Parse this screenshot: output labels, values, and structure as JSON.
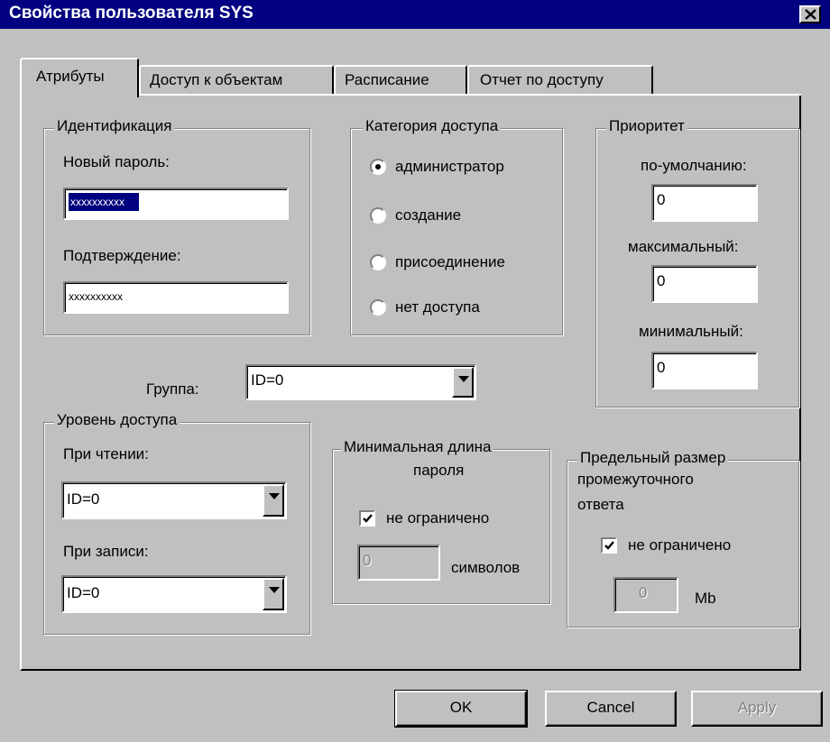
{
  "window": {
    "title": "Свойства пользователя SYS",
    "close_icon": "close-icon"
  },
  "tabs": [
    {
      "label": "Атрибуты",
      "active": true
    },
    {
      "label": "Доступ к объектам",
      "active": false
    },
    {
      "label": "Расписание",
      "active": false
    },
    {
      "label": "Отчет по доступу",
      "active": false
    }
  ],
  "identification": {
    "legend": "Идентификация",
    "new_password_label": "Новый пароль:",
    "new_password_value": "xxxxxxxxxx",
    "confirm_label": "Подтверждение:",
    "confirm_value": "xxxxxxxxxx"
  },
  "access_category": {
    "legend": "Категория доступа",
    "options": [
      {
        "label": "администратор",
        "selected": true
      },
      {
        "label": "создание",
        "selected": false
      },
      {
        "label": "присоединение",
        "selected": false
      },
      {
        "label": "нет доступа",
        "selected": false
      }
    ]
  },
  "priority": {
    "legend": "Приоритет",
    "default_label": "по-умолчанию:",
    "default_value": "0",
    "max_label": "максимальный:",
    "max_value": "0",
    "min_label": "минимальный:",
    "min_value": "0"
  },
  "group": {
    "label": "Группа:",
    "value": "ID=0"
  },
  "access_level": {
    "legend": "Уровень доступа",
    "read_label": "При чтении:",
    "read_value": "ID=0",
    "write_label": "При записи:",
    "write_value": "ID=0"
  },
  "min_password": {
    "legend_line1": "Минимальная длина",
    "legend_line2": "пароля",
    "unlimited_label": "не ограничено",
    "unlimited_checked": true,
    "length_value": "0",
    "unit_label": "символов"
  },
  "response_limit": {
    "legend": "Предельный размер",
    "line2": "промежуточного",
    "line3": "ответа",
    "unlimited_label": "не ограничено",
    "unlimited_checked": true,
    "size_value": "0",
    "unit_label": "Mb"
  },
  "buttons": {
    "ok": "OK",
    "cancel": "Cancel",
    "apply": "Apply"
  },
  "colors": {
    "titlebar": "#000080",
    "face": "#c0c0c0",
    "selection": "#000080"
  }
}
